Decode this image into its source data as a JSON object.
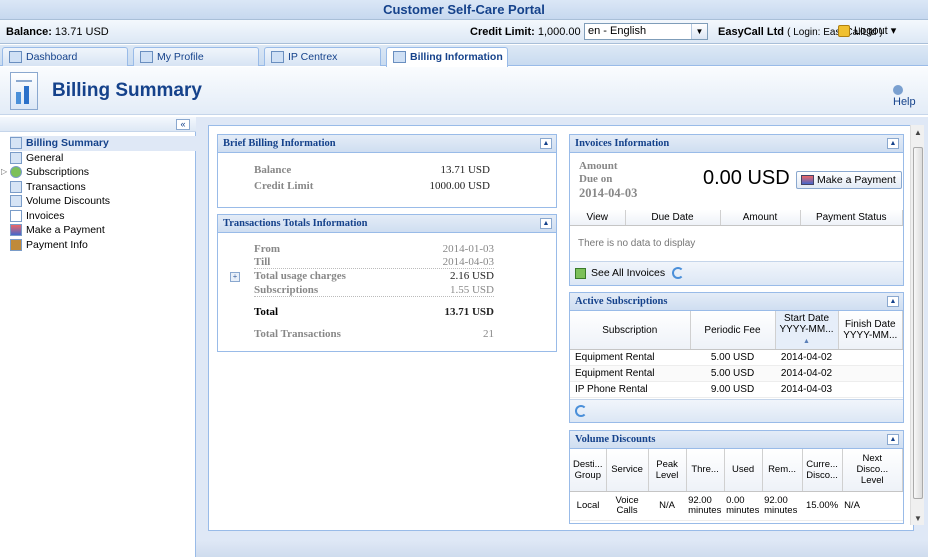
{
  "app_title": "Customer Self-Care Portal",
  "infobar": {
    "balance_label": "Balance:",
    "balance_value": "13.71 USD",
    "credit_label": "Credit Limit:",
    "credit_value": "1,000.00 USD",
    "language": "en - English",
    "company": "EasyCall Ltd",
    "login": "( Login: EasyCallLtd )",
    "logout": "Logout"
  },
  "tabs": [
    {
      "label": "Dashboard"
    },
    {
      "label": "My Profile"
    },
    {
      "label": "IP Centrex"
    },
    {
      "label": "Billing Information"
    }
  ],
  "header": {
    "title": "Billing Summary",
    "help": "Help"
  },
  "sidebar": {
    "items": [
      {
        "label": "Billing Summary"
      },
      {
        "label": "General"
      },
      {
        "label": "Subscriptions"
      },
      {
        "label": "Transactions"
      },
      {
        "label": "Volume Discounts"
      },
      {
        "label": "Invoices"
      },
      {
        "label": "Make a Payment"
      },
      {
        "label": "Payment Info"
      }
    ]
  },
  "brief": {
    "title": "Brief Billing Information",
    "balance_label": "Balance",
    "balance_value": "13.71 USD",
    "credit_label": "Credit Limit",
    "credit_value": "1000.00 USD"
  },
  "totals": {
    "title": "Transactions Totals Information",
    "from_label": "From",
    "from_value": "2014-01-03",
    "till_label": "Till",
    "till_value": "2014-04-03",
    "usage_label": "Total usage charges",
    "usage_value": "2.16 USD",
    "subs_label": "Subscriptions",
    "subs_value": "1.55 USD",
    "total_label": "Total",
    "total_value": "13.71 USD",
    "tx_label": "Total Transactions",
    "tx_value": "21"
  },
  "invoices": {
    "title": "Invoices Information",
    "amount_label": "Amount",
    "due_label": "Due on",
    "due_date": "2014-04-03",
    "amount_value": "0.00 USD",
    "pay_button": "Make a Payment",
    "columns": [
      "View",
      "Due Date",
      "Amount",
      "Payment Status"
    ],
    "empty": "There is no data to display",
    "see_all": "See All Invoices"
  },
  "subscriptions": {
    "title": "Active Subscriptions",
    "columns": [
      "Subscription",
      "Periodic Fee",
      "Start Date",
      "YYYY-MM...",
      "Finish Date",
      "YYYY-MM..."
    ],
    "rows": [
      {
        "name": "Equipment Rental",
        "fee": "5.00 USD",
        "start": "2014-04-02",
        "finish": ""
      },
      {
        "name": "Equipment Rental",
        "fee": "5.00 USD",
        "start": "2014-04-02",
        "finish": ""
      },
      {
        "name": "IP Phone Rental",
        "fee": "9.00 USD",
        "start": "2014-04-03",
        "finish": ""
      }
    ]
  },
  "volume": {
    "title": "Volume Discounts",
    "columns": [
      "Desti... Group",
      "Service",
      "Peak Level",
      "Thre...",
      "Used",
      "Rem...",
      "Curre... Disco...",
      "Next Disco... Level"
    ],
    "row": [
      "Local",
      "Voice Calls",
      "N/A",
      "92.00 minutes",
      "0.00 minutes",
      "92.00 minutes",
      "15.00%",
      "N/A"
    ]
  }
}
